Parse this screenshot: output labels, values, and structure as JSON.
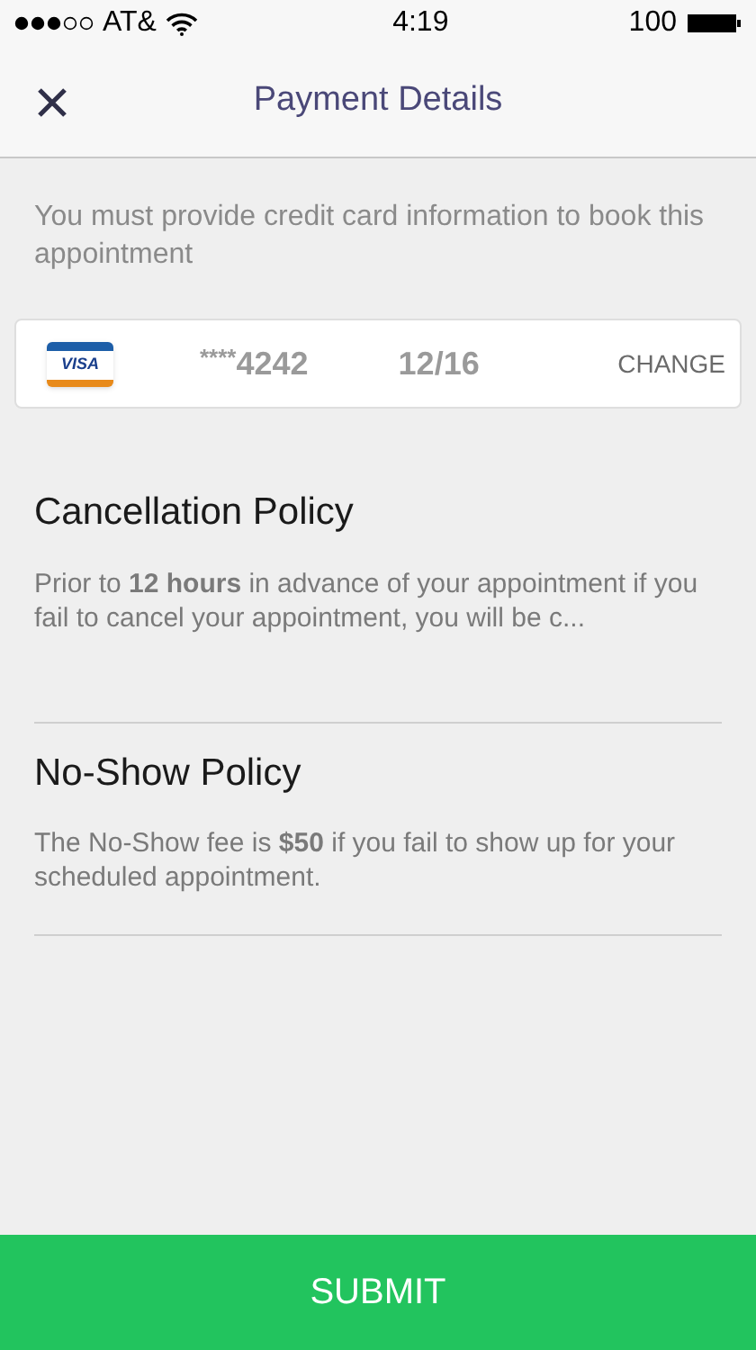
{
  "status_bar": {
    "carrier": "AT&",
    "time": "4:19",
    "battery": "100"
  },
  "header": {
    "title": "Payment Details"
  },
  "notice": "You must provide credit card information to book this appointment",
  "card": {
    "brand": "VISA",
    "stars": "****",
    "last4": "4242",
    "expiry": "12/16",
    "action": "CHANGE"
  },
  "policies": [
    {
      "title": "Cancellation Policy",
      "text": "Prior to **12 hours** in advance of your appointment if you fail to cancel your appointment, you will be c..."
    },
    {
      "title": "No-Show Policy",
      "text": "The No-Show fee is **$50** if you fail to show up for your scheduled appointment."
    }
  ],
  "submit": "SUBMIT"
}
